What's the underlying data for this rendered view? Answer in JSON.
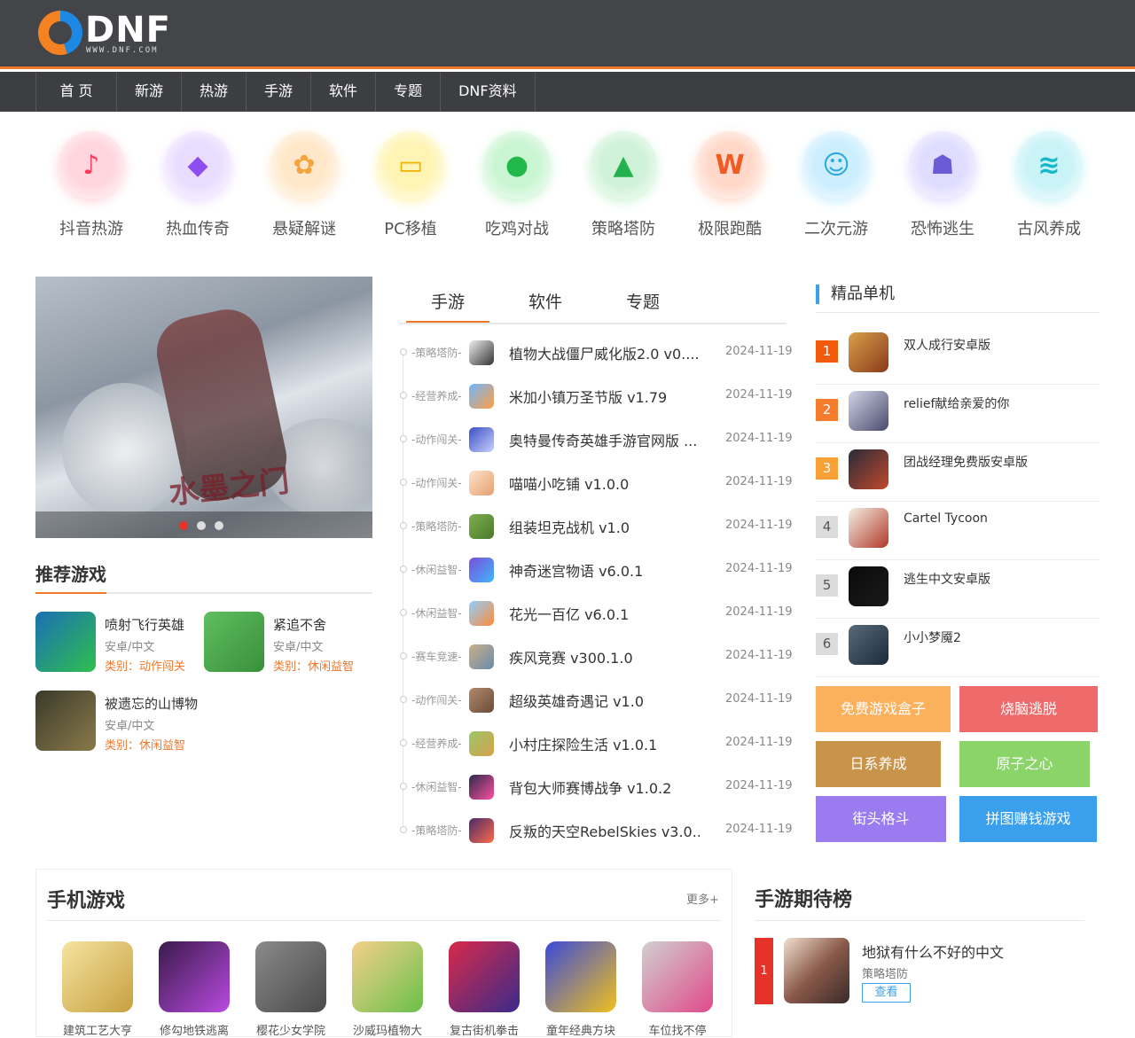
{
  "logo": {
    "text": "DNF",
    "sub": "WWW.DNF.COM"
  },
  "nav": [
    "首 页",
    "新游",
    "热游",
    "手游",
    "软件",
    "专题",
    "DNF资料"
  ],
  "categories": [
    {
      "label": "抖音热游",
      "icon": "tiktok-icon",
      "color": "#ff3b5c",
      "glow": "#ffd6de",
      "glyph": "♪"
    },
    {
      "label": "热血传奇",
      "icon": "crystal-icon",
      "color": "#8d4df0",
      "glow": "#eadcff",
      "glyph": "◆"
    },
    {
      "label": "悬疑解谜",
      "icon": "brain-icon",
      "color": "#f5a33a",
      "glow": "#ffe8c9",
      "glyph": "✿"
    },
    {
      "label": "PC移植",
      "icon": "laptop-icon",
      "color": "#f0b400",
      "glow": "#fff4b3",
      "glyph": "▭"
    },
    {
      "label": "吃鸡对战",
      "icon": "helmet-icon",
      "color": "#22b94a",
      "glow": "#c9f5d2",
      "glyph": "●"
    },
    {
      "label": "策略塔防",
      "icon": "tent-icon",
      "color": "#23b24d",
      "glow": "#cff2d8",
      "glyph": "▲"
    },
    {
      "label": "极限跑酷",
      "icon": "win-icon",
      "color": "#ef5b23",
      "glow": "#ffd8c9",
      "glyph": "W"
    },
    {
      "label": "二次元游",
      "icon": "robot-icon",
      "color": "#2ba7e0",
      "glow": "#cceeff",
      "glyph": "☺"
    },
    {
      "label": "恐怖逃生",
      "icon": "ghost-icon",
      "color": "#6d5bd6",
      "glow": "#e0dcff",
      "glyph": "☗"
    },
    {
      "label": "古风养成",
      "icon": "scholar-icon",
      "color": "#14b8c8",
      "glow": "#c9f3f7",
      "glyph": "≋"
    }
  ],
  "slider": {
    "caption": "水墨之门"
  },
  "recommended": {
    "title": "推荐游戏",
    "items": [
      {
        "name": "喷射飞行英雄",
        "meta": "安卓/中文",
        "type": "类别：动作闯关",
        "c1": "#1b6fb3",
        "c2": "#2fbf4f"
      },
      {
        "name": "紧追不舍",
        "meta": "安卓/中文",
        "type": "类别：休闲益智",
        "c1": "#5fbf5f",
        "c2": "#3a8f3a"
      },
      {
        "name": "被遗忘的山博物",
        "meta": "安卓/中文",
        "type": "类别：休闲益智",
        "c1": "#3a3a2a",
        "c2": "#8a7a4a"
      }
    ]
  },
  "tabs": [
    "手游",
    "软件",
    "专题"
  ],
  "list": [
    {
      "cat": "-策略塔防-",
      "title": "植物大战僵尸威化版2.0 v0....",
      "date": "2024-11-19",
      "c1": "#eeeeee",
      "c2": "#333333"
    },
    {
      "cat": "-经营养成-",
      "title": "米加小镇万圣节版 v1.79",
      "date": "2024-11-19",
      "c1": "#6fb6ff",
      "c2": "#ff9f43"
    },
    {
      "cat": "-动作闯关-",
      "title": "奥特曼传奇英雄手游官网版 ...",
      "date": "2024-11-19",
      "c1": "#3b4fc4",
      "c2": "#c8d0ff"
    },
    {
      "cat": "-动作闯关-",
      "title": "喵喵小吃铺 v1.0.0",
      "date": "2024-11-19",
      "c1": "#ffe2c9",
      "c2": "#e3a070"
    },
    {
      "cat": "-策略塔防-",
      "title": "组装坦克战机 v1.0",
      "date": "2024-11-19",
      "c1": "#7fae4f",
      "c2": "#4a7a2a"
    },
    {
      "cat": "-休闲益智-",
      "title": "神奇迷宫物语 v6.0.1",
      "date": "2024-11-19",
      "c1": "#7a4fd6",
      "c2": "#3fb6ff"
    },
    {
      "cat": "-休闲益智-",
      "title": "花光一百亿 v6.0.1",
      "date": "2024-11-19",
      "c1": "#8fd0ff",
      "c2": "#ff8a3a"
    },
    {
      "cat": "-赛车竞速-",
      "title": "疾风竞赛 v300.1.0",
      "date": "2024-11-19",
      "c1": "#c8b08a",
      "c2": "#6a8aaa"
    },
    {
      "cat": "-动作闯关-",
      "title": "超级英雄奇遇记 v1.0",
      "date": "2024-11-19",
      "c1": "#b08a6a",
      "c2": "#6a4a3a"
    },
    {
      "cat": "-经营养成-",
      "title": "小村庄探险生活 v1.0.1",
      "date": "2024-11-19",
      "c1": "#9ac86a",
      "c2": "#d6a04a"
    },
    {
      "cat": "-休闲益智-",
      "title": "背包大师赛博战争 v1.0.2",
      "date": "2024-11-19",
      "c1": "#2a2a4a",
      "c2": "#ff4fa0"
    },
    {
      "cat": "-策略塔防-",
      "title": "反叛的天空RebelSkies v3.0...",
      "date": "2024-11-19",
      "c1": "#4a2a6a",
      "c2": "#ff6a4a"
    }
  ],
  "side": {
    "title": "精品单机",
    "ranks": [
      {
        "num": "1",
        "name": "双人成行安卓版",
        "bg": "#f25a0c",
        "c1": "#d8a04a",
        "c2": "#8a3a1a"
      },
      {
        "num": "2",
        "name": "relief献给亲爱的你",
        "bg": "#f57b2d",
        "c1": "#d0d4e8",
        "c2": "#4a4a6a"
      },
      {
        "num": "3",
        "name": "团战经理免费版安卓版",
        "bg": "#f9a037",
        "c1": "#2a2a3a",
        "c2": "#c04a2a"
      },
      {
        "num": "4",
        "name": "Cartel Tycoon",
        "bg": "#dcdcdc",
        "c1": "#f4f0e4",
        "c2": "#b03a2a"
      },
      {
        "num": "5",
        "name": "逃生中文安卓版",
        "bg": "#dcdcdc",
        "c1": "#0a0a0a",
        "c2": "#1a1a1a"
      },
      {
        "num": "6",
        "name": "小小梦魇2",
        "bg": "#dcdcdc",
        "c1": "#5a6a7a",
        "c2": "#1a2a3a"
      }
    ],
    "tags": [
      {
        "label": "免费游戏盒子",
        "color": "#fbb05c"
      },
      {
        "label": "烧脑逃脱",
        "color": "#ef6b6b"
      },
      {
        "label": "日系养成",
        "color": "#c8944a"
      },
      {
        "label": "原子之心",
        "color": "#8ad46a"
      },
      {
        "label": "街头格斗",
        "color": "#9b7cf0"
      },
      {
        "label": "拼图赚钱游戏",
        "color": "#3aa0ee"
      }
    ]
  },
  "mobile": {
    "title": "手机游戏",
    "more": "更多+",
    "games": [
      {
        "name": "建筑工艺大亨",
        "c1": "#f4e3a0",
        "c2": "#c8a040"
      },
      {
        "name": "修勾地铁逃离",
        "c1": "#3a1a4a",
        "c2": "#b84ae0"
      },
      {
        "name": "樱花少女学院",
        "c1": "#8a8a8a",
        "c2": "#4a4a4a"
      },
      {
        "name": "沙威玛植物大",
        "c1": "#f4d08a",
        "c2": "#6ac04a"
      },
      {
        "name": "复古街机拳击",
        "c1": "#d82a4a",
        "c2": "#3a2a8a"
      },
      {
        "name": "童年经典方块",
        "c1": "#3a4ad8",
        "c2": "#f0c020"
      },
      {
        "name": "车位找不停",
        "c1": "#d0d0d0",
        "c2": "#e04a8a"
      }
    ]
  },
  "expect": {
    "title": "手游期待榜",
    "num": "1",
    "name": "地狱有什么不好的中文",
    "cat": "策略塔防",
    "btn": "查看"
  }
}
